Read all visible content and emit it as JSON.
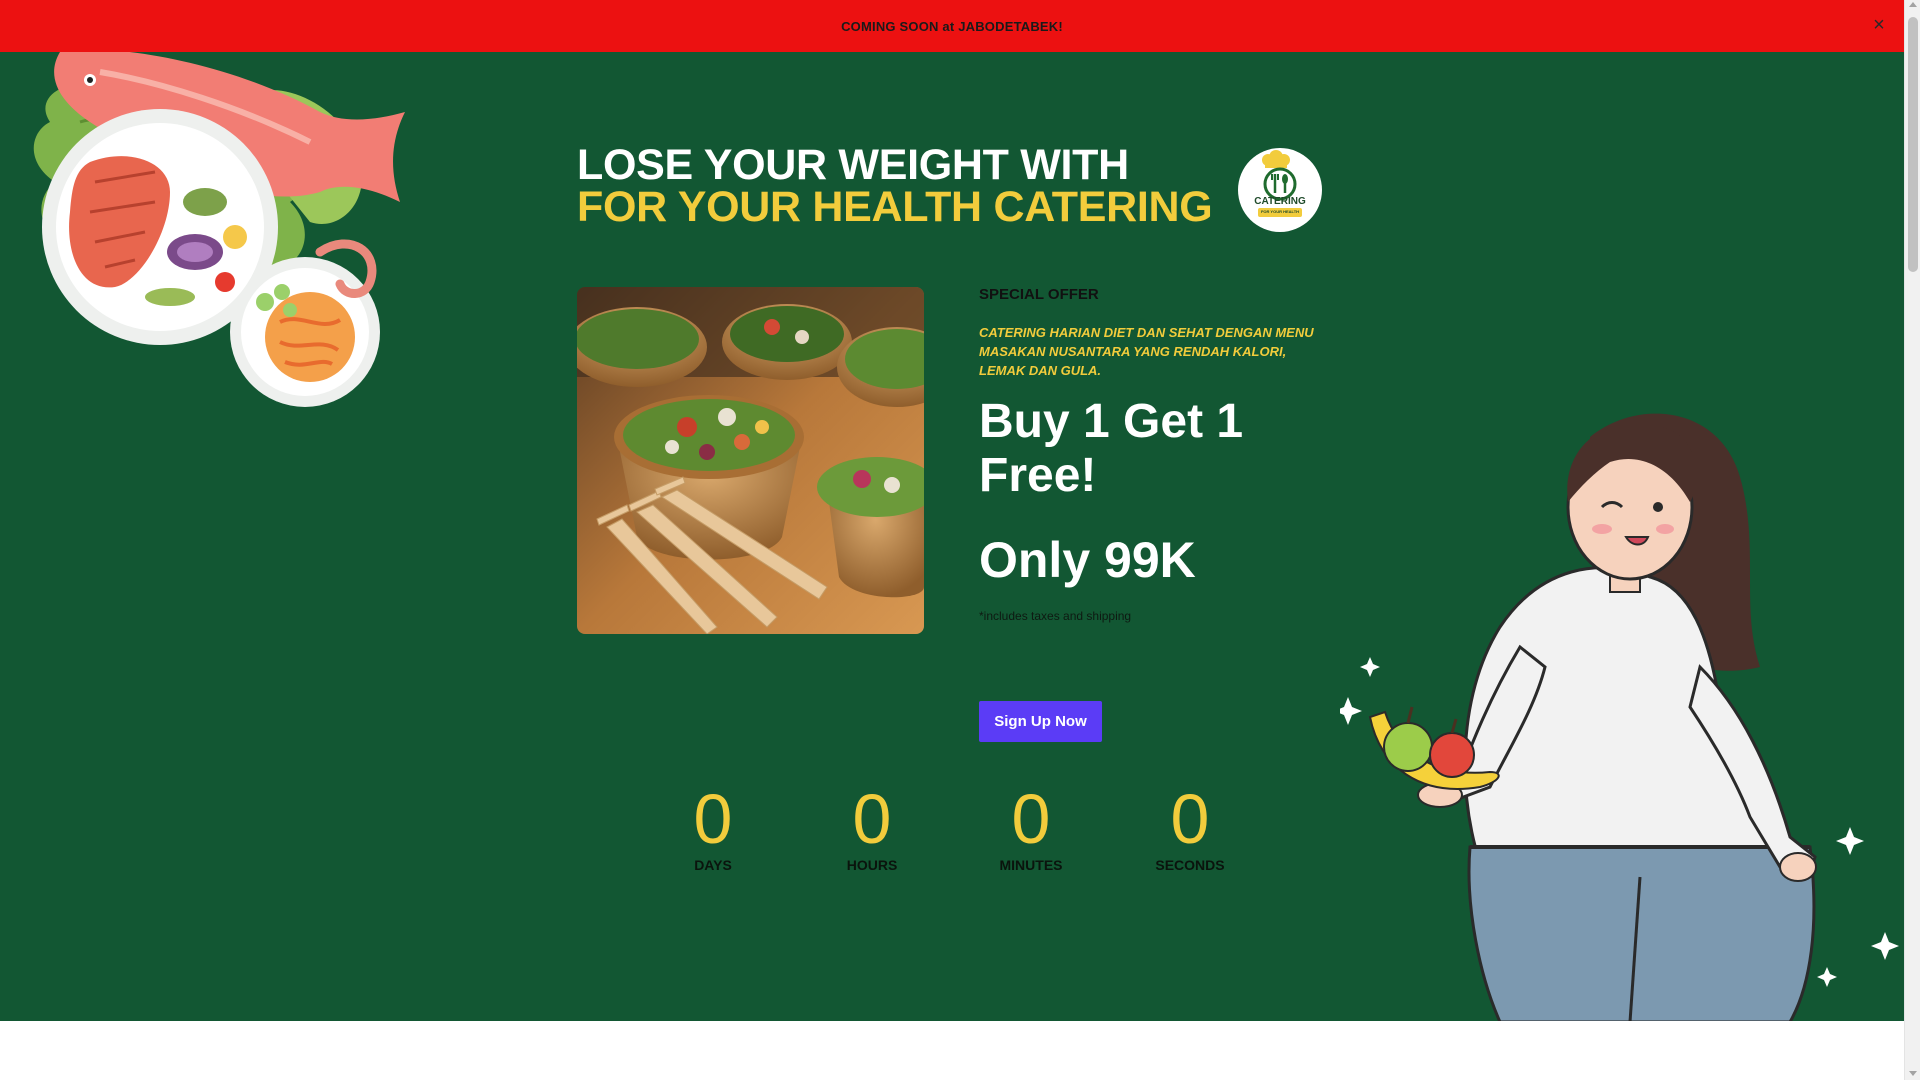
{
  "announcement": {
    "text": "COMING SOON at JABODETABEK!",
    "close_icon": "×"
  },
  "hero": {
    "headline_line1": "LOSE YOUR WEIGHT WITH",
    "headline_line2": "FOR YOUR HEALTH CATERING",
    "logo": {
      "text": "CATERING",
      "tagline": "FOR YOUR HEALTH"
    },
    "offer_label": "SPECIAL OFFER",
    "offer_description": "CATERING HARIAN DIET DAN SEHAT DENGAN MENU MASAKAN NUSANTARA YANG RENDAH KALORI, LEMAK DAN GULA.",
    "offer_big": "Buy 1 Get 1 Free!",
    "offer_price": "Only 99K",
    "offer_note": "*includes taxes and shipping",
    "cta_label": "Sign Up Now"
  },
  "countdown": [
    {
      "value": "0",
      "label": "DAYS"
    },
    {
      "value": "0",
      "label": "HOURS"
    },
    {
      "value": "0",
      "label": "MINUTES"
    },
    {
      "value": "0",
      "label": "SECONDS"
    }
  ],
  "colors": {
    "banner": "#ec1111",
    "hero_bg": "#125733",
    "accent_yellow": "#f2cc3c",
    "cta": "#5b3cf6"
  },
  "icons": [
    "close-icon",
    "catering-logo",
    "scroll-up-arrow",
    "scroll-down-arrow"
  ]
}
